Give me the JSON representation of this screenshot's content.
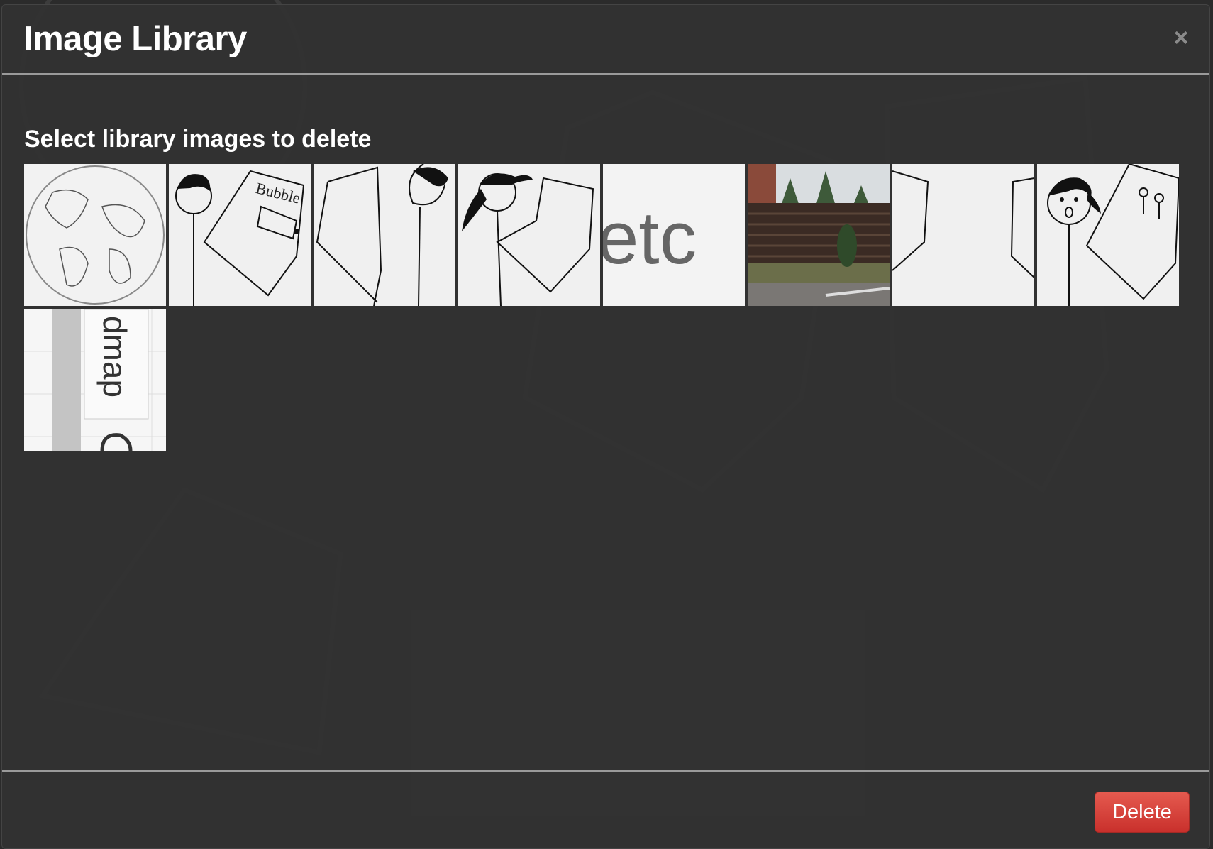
{
  "modal": {
    "title": "Image Library",
    "close_glyph": "×",
    "instructions": "Select library images to delete",
    "delete_label": "Delete"
  },
  "thumbnails": [
    {
      "icon": "globe-sketch"
    },
    {
      "icon": "stick-figure-laptop-bubble"
    },
    {
      "icon": "laptop-stick-figure"
    },
    {
      "icon": "stick-figure-ponytail-laptop"
    },
    {
      "icon": "etch-text-crop",
      "text": "etc"
    },
    {
      "icon": "fence-photo"
    },
    {
      "icon": "laptop-edges-sketch"
    },
    {
      "icon": "stick-figure-laptop-diagram"
    },
    {
      "icon": "roadmap-text-rotated",
      "text": "dmap"
    }
  ]
}
